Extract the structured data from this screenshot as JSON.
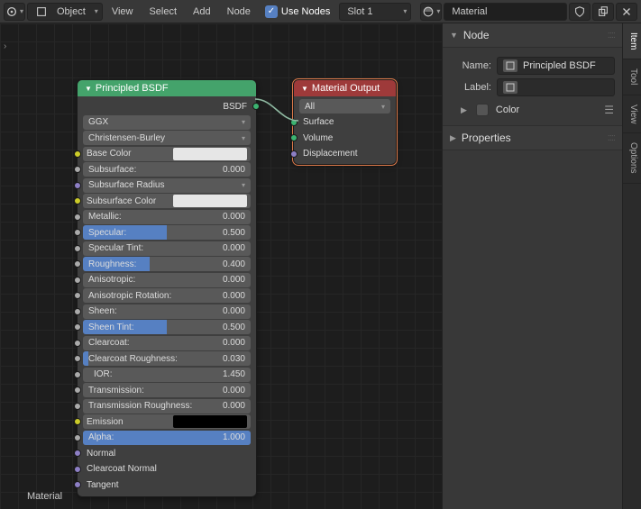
{
  "header": {
    "mode": "Object",
    "menus": [
      "View",
      "Select",
      "Add",
      "Node"
    ],
    "use_nodes_label": "Use Nodes",
    "slot": "Slot 1",
    "material_name": "Material"
  },
  "breadcrumb": "›",
  "material_label": "Material",
  "principled": {
    "title": "Principled BSDF",
    "out_socket": "BSDF",
    "distribution": "GGX",
    "subsurface_method": "Christensen-Burley",
    "props": [
      {
        "type": "color",
        "label": "Base Color",
        "color": "white",
        "sock": "yellow"
      },
      {
        "type": "slider",
        "label": "Subsurface:",
        "value": "0.000",
        "fill": 0,
        "sock": "grey"
      },
      {
        "type": "drop",
        "label": "Subsurface Radius",
        "sock": "purple"
      },
      {
        "type": "color",
        "label": "Subsurface Color",
        "color": "white",
        "sock": "yellow"
      },
      {
        "type": "slider",
        "label": "Metallic:",
        "value": "0.000",
        "fill": 0,
        "sock": "grey"
      },
      {
        "type": "slider",
        "label": "Specular:",
        "value": "0.500",
        "fill": 50,
        "sock": "grey"
      },
      {
        "type": "slider",
        "label": "Specular Tint:",
        "value": "0.000",
        "fill": 0,
        "sock": "grey"
      },
      {
        "type": "slider",
        "label": "Roughness:",
        "value": "0.400",
        "fill": 40,
        "sock": "grey"
      },
      {
        "type": "slider",
        "label": "Anisotropic:",
        "value": "0.000",
        "fill": 0,
        "sock": "grey"
      },
      {
        "type": "slider",
        "label": "Anisotropic Rotation:",
        "value": "0.000",
        "fill": 0,
        "sock": "grey"
      },
      {
        "type": "slider",
        "label": "Sheen:",
        "value": "0.000",
        "fill": 0,
        "sock": "grey"
      },
      {
        "type": "slider",
        "label": "Sheen Tint:",
        "value": "0.500",
        "fill": 50,
        "sock": "grey"
      },
      {
        "type": "slider",
        "label": "Clearcoat:",
        "value": "0.000",
        "fill": 0,
        "sock": "grey"
      },
      {
        "type": "slider",
        "label": "Clearcoat Roughness:",
        "value": "0.030",
        "fill": 3,
        "sock": "grey"
      },
      {
        "type": "slider",
        "label": "IOR:",
        "value": "1.450",
        "fill": 0,
        "sock": "grey",
        "indent": true
      },
      {
        "type": "slider",
        "label": "Transmission:",
        "value": "0.000",
        "fill": 0,
        "sock": "grey"
      },
      {
        "type": "slider",
        "label": "Transmission Roughness:",
        "value": "0.000",
        "fill": 0,
        "sock": "grey"
      },
      {
        "type": "color",
        "label": "Emission",
        "color": "black",
        "sock": "yellow"
      },
      {
        "type": "slider",
        "label": "Alpha:",
        "value": "1.000",
        "fill": 100,
        "sock": "grey"
      },
      {
        "type": "link",
        "label": "Normal",
        "sock": "purple"
      },
      {
        "type": "link",
        "label": "Clearcoat Normal",
        "sock": "purple"
      },
      {
        "type": "link",
        "label": "Tangent",
        "sock": "purple"
      }
    ]
  },
  "output": {
    "title": "Material Output",
    "target": "All",
    "inputs": [
      "Surface",
      "Volume",
      "Displacement"
    ]
  },
  "sidebar": {
    "node_title": "Node",
    "name_label": "Name:",
    "name_value": "Principled BSDF",
    "label_label": "Label:",
    "label_value": "",
    "color_label": "Color",
    "props_title": "Properties"
  },
  "tabs": [
    "Item",
    "Tool",
    "View",
    "Options"
  ]
}
